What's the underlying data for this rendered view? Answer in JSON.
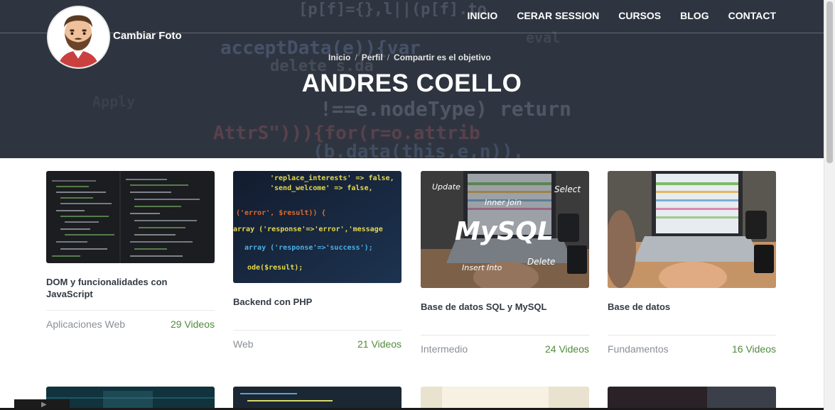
{
  "header": {
    "change_photo": "Cambiar Foto",
    "nav": [
      "INICIO",
      "CERAR SESSION",
      "CURSOS",
      "BLOG",
      "CONTACT"
    ],
    "breadcrumb": [
      "Inicio",
      "Perfil",
      "Compartir es el objetivo"
    ],
    "title": "ANDRES COELLO"
  },
  "code_overlay": [
    "acceptData(e)){var",
    "delete s.da",
    "!==e.nodeType) return",
    "AttrS\"))){for(r=o.attrib",
    "(b.data(this,e,n)),",
    "[p[f]={},l||(p[f].to",
    "eval",
    "Apply"
  ],
  "courses": [
    {
      "title": "DOM y funcionalidades con JavaScript",
      "category": "Aplicaciones Web",
      "videos": "29 Videos"
    },
    {
      "title": "Backend con PHP",
      "category": "Web",
      "videos": "21 Videos"
    },
    {
      "title": "Base de datos SQL y MySQL",
      "category": "Intermedio",
      "videos": "24 Videos"
    },
    {
      "title": "Base de datos",
      "category": "Fundamentos",
      "videos": "16 Videos"
    }
  ],
  "thumb_text": {
    "php": [
      "'replace_interests' => false,",
      "'send_welcome'        => false,",
      "('error', $result)) {",
      "array ('response'=>'error','message",
      "array ('response'=>'success');",
      "ode($result);"
    ],
    "mysql": {
      "logo": "MySQL",
      "update": "Update",
      "select": "Select",
      "inner_join": "Inner Join",
      "insert_into": "Insert Into",
      "delete": "Delete"
    }
  },
  "colors": {
    "accent_green": "#4f8b3a",
    "title_dark": "#333a44",
    "muted": "#8a8f96"
  }
}
